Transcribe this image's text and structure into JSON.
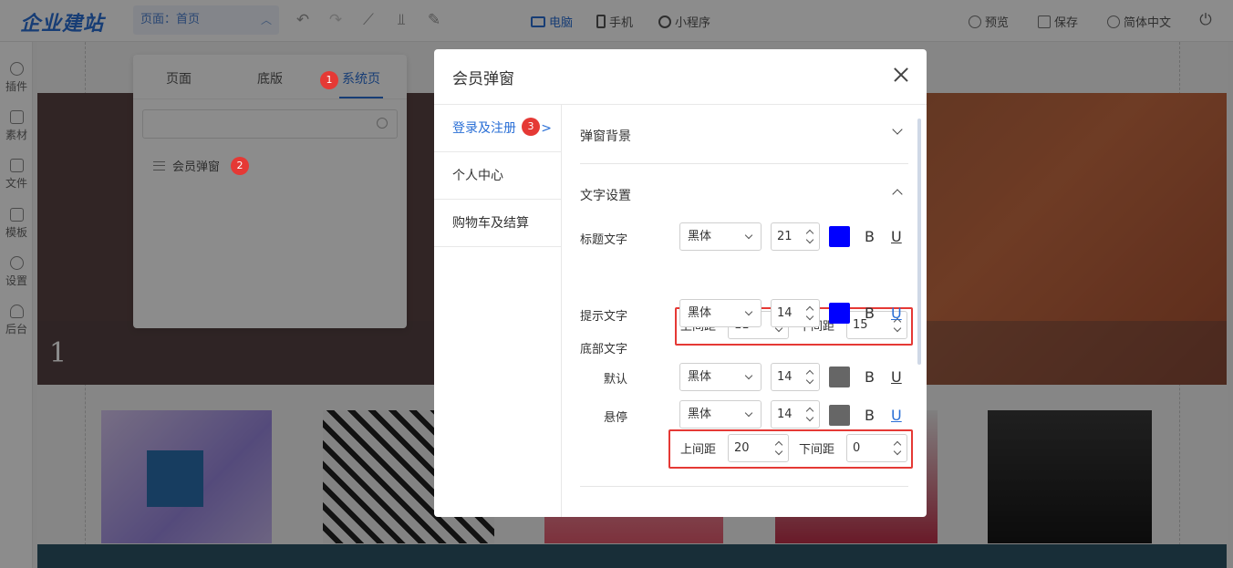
{
  "app": {
    "logo": "企业建站"
  },
  "toolbar": {
    "page_select_label": "页面：",
    "page_select_value": "首页",
    "devices": [
      "电脑",
      "手机",
      "小程序"
    ],
    "preview": "预览",
    "save": "保存",
    "language": "简体中文"
  },
  "rail": [
    "插件",
    "素材",
    "文件",
    "模板",
    "设置",
    "后台"
  ],
  "canvas": {
    "banner_number": "1"
  },
  "page_panel": {
    "tabs": [
      "页面",
      "底版",
      "系统页"
    ],
    "active_tab": "系统页",
    "search_placeholder": "",
    "items": [
      "会员弹窗"
    ]
  },
  "badges": [
    "1",
    "2",
    "3"
  ],
  "modal": {
    "title": "会员弹窗",
    "nav": [
      {
        "label": "登录及注册",
        "active": true
      },
      {
        "label": "个人中心",
        "active": false
      },
      {
        "label": "购物车及结算",
        "active": false
      }
    ],
    "sections": {
      "background": "弹窗背景",
      "text_settings": "文字设置"
    },
    "title_text": {
      "label": "标题文字",
      "font": "黑体",
      "size": "21",
      "color": "#0000ff",
      "bold": "B",
      "underline": "U",
      "top_label": "上间距",
      "top": "11",
      "bottom_label": "下间距",
      "bottom": "15"
    },
    "hint_text": {
      "label": "提示文字",
      "font": "黑体",
      "size": "14",
      "color": "#0000ff",
      "bold": "B",
      "underline": "U"
    },
    "footer_text": {
      "label": "底部文字",
      "default": {
        "label": "默认",
        "font": "黑体",
        "size": "14",
        "color": "#666666",
        "bold": "B",
        "underline": "U"
      },
      "hover": {
        "label": "悬停",
        "font": "黑体",
        "size": "14",
        "color": "#666666",
        "bold": "B",
        "underline": "U"
      },
      "top_label": "上间距",
      "top": "20",
      "bottom_label": "下间距",
      "bottom": "0"
    }
  }
}
